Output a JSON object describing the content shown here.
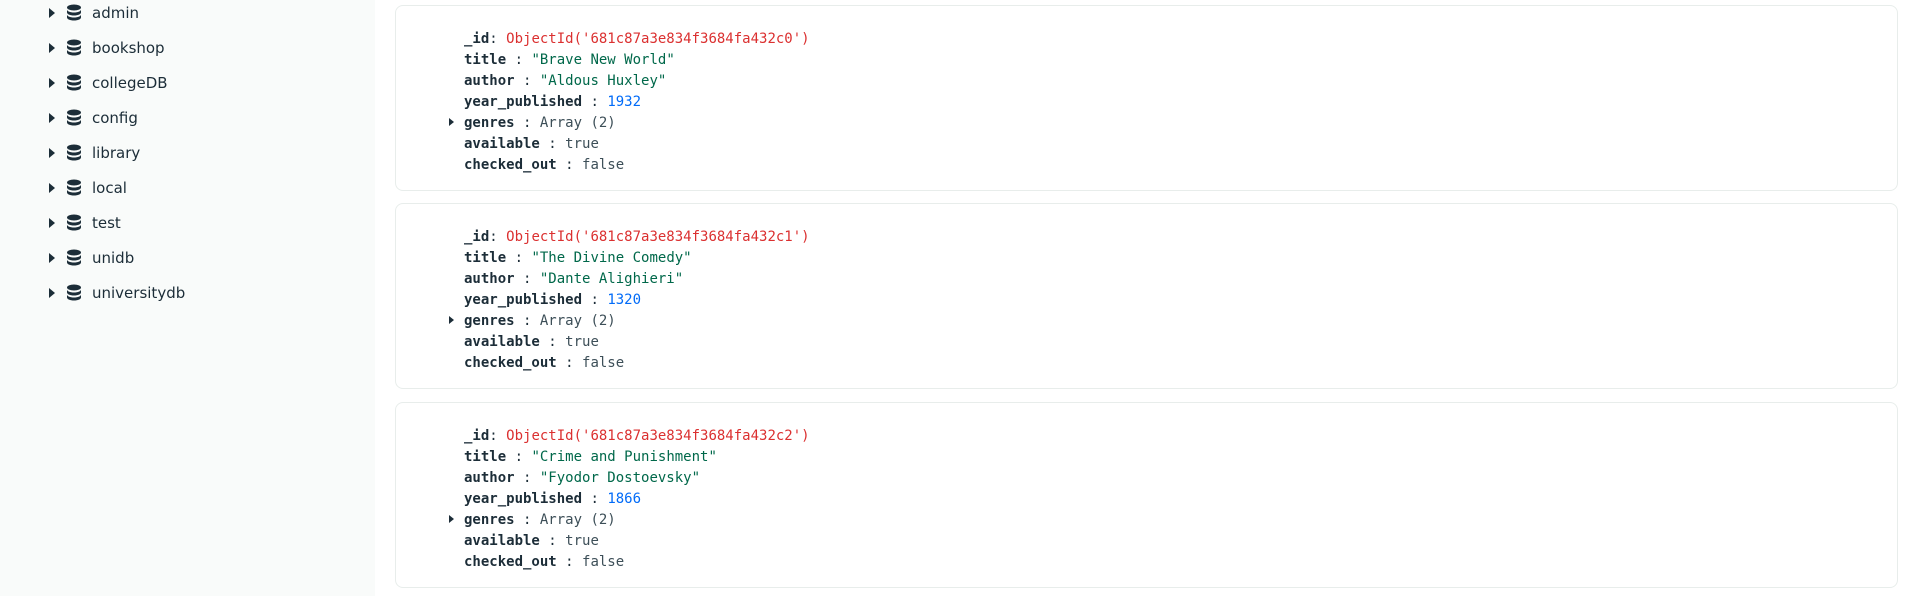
{
  "sidebar": {
    "databases": [
      {
        "label": "admin"
      },
      {
        "label": "bookshop"
      },
      {
        "label": "collegeDB"
      },
      {
        "label": "config"
      },
      {
        "label": "library"
      },
      {
        "label": "local"
      },
      {
        "label": "test"
      },
      {
        "label": "unidb"
      },
      {
        "label": "universitydb"
      }
    ]
  },
  "documents": [
    {
      "id_key": "_id",
      "id_value": "ObjectId('681c87a3e834f3684fa432c0')",
      "title_key": "title",
      "title_value": "\"Brave New World\"",
      "author_key": "author",
      "author_value": "\"Aldous Huxley\"",
      "year_key": "year_published",
      "year_value": "1932",
      "genres_key": "genres",
      "genres_value": "Array (2)",
      "available_key": "available",
      "available_value": "true",
      "checked_out_key": "checked_out",
      "checked_out_value": "false"
    },
    {
      "id_key": "_id",
      "id_value": "ObjectId('681c87a3e834f3684fa432c1')",
      "title_key": "title",
      "title_value": "\"The Divine Comedy\"",
      "author_key": "author",
      "author_value": "\"Dante Alighieri\"",
      "year_key": "year_published",
      "year_value": "1320",
      "genres_key": "genres",
      "genres_value": "Array (2)",
      "available_key": "available",
      "available_value": "true",
      "checked_out_key": "checked_out",
      "checked_out_value": "false"
    },
    {
      "id_key": "_id",
      "id_value": "ObjectId('681c87a3e834f3684fa432c2')",
      "title_key": "title",
      "title_value": "\"Crime and Punishment\"",
      "author_key": "author",
      "author_value": "\"Fyodor Dostoevsky\"",
      "year_key": "year_published",
      "year_value": "1866",
      "genres_key": "genres",
      "genres_value": "Array (2)",
      "available_key": "available",
      "available_value": "true",
      "checked_out_key": "checked_out",
      "checked_out_value": "false"
    }
  ],
  "colors": {
    "sidebar_bg": "#f9fbfa",
    "objectid": "#db3030",
    "string": "#00684a",
    "number": "#016bf8",
    "plain": "#3d4f58"
  },
  "icons": {
    "db_item_icon": "database-icon",
    "expand_icon": "caret-right-icon"
  }
}
